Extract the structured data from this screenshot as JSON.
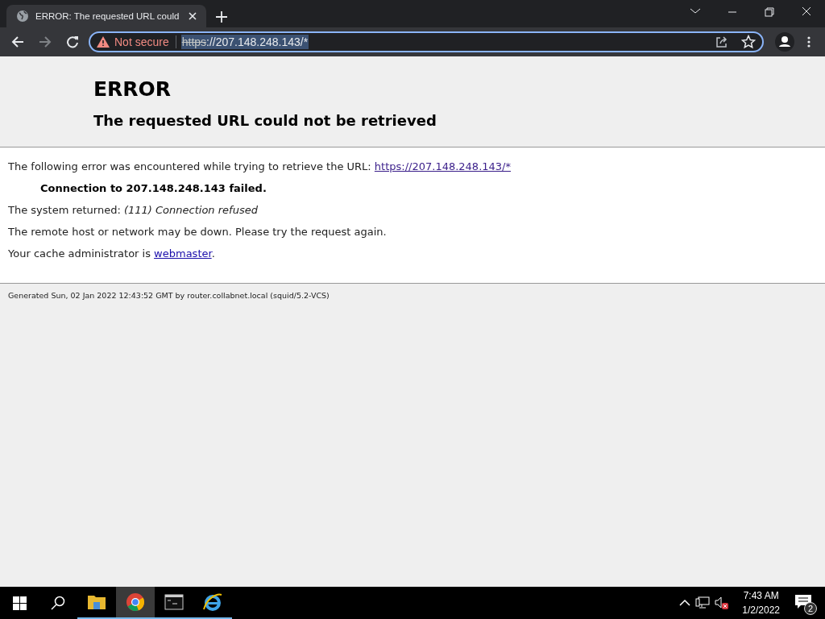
{
  "browser": {
    "tab": {
      "title": "ERROR: The requested URL could",
      "selected": true
    },
    "address": {
      "security": "Not secure",
      "scheme": "https",
      "rest": "://207.148.248.143/*"
    }
  },
  "page": {
    "title": "ERROR",
    "subtitle": "The requested URL could not be retrieved",
    "paragraphs": [
      {
        "kind": "link",
        "text": "The following error was encountered while trying to retrieve the URL: ",
        "link": "https://207.148.248.143/*"
      },
      {
        "kind": "strong",
        "text": "Connection to 207.148.248.143 failed."
      },
      {
        "kind": "plain",
        "text": "The system returned: *(111) Connection refused*"
      },
      {
        "kind": "plain",
        "text": "The remote host or network may be down. Please try the request again."
      },
      {
        "kind": "link",
        "text": "Your cache administrator is ",
        "link": "webmaster",
        "after": "."
      }
    ],
    "footer": "Generated Sun, 02 Jan 2022 12:43:52 GMT by router.collabnet.local (squid/5.2-VCS)"
  },
  "taskbar": {
    "apps": [
      {
        "kind": "files",
        "selected": false
      },
      {
        "kind": "chrome",
        "selected": true
      },
      {
        "kind": "terminal",
        "selected": false
      },
      {
        "kind": "ie",
        "selected": false
      }
    ],
    "time": "7:43 AM",
    "date": "1/2/2022",
    "notifications": "2"
  }
}
